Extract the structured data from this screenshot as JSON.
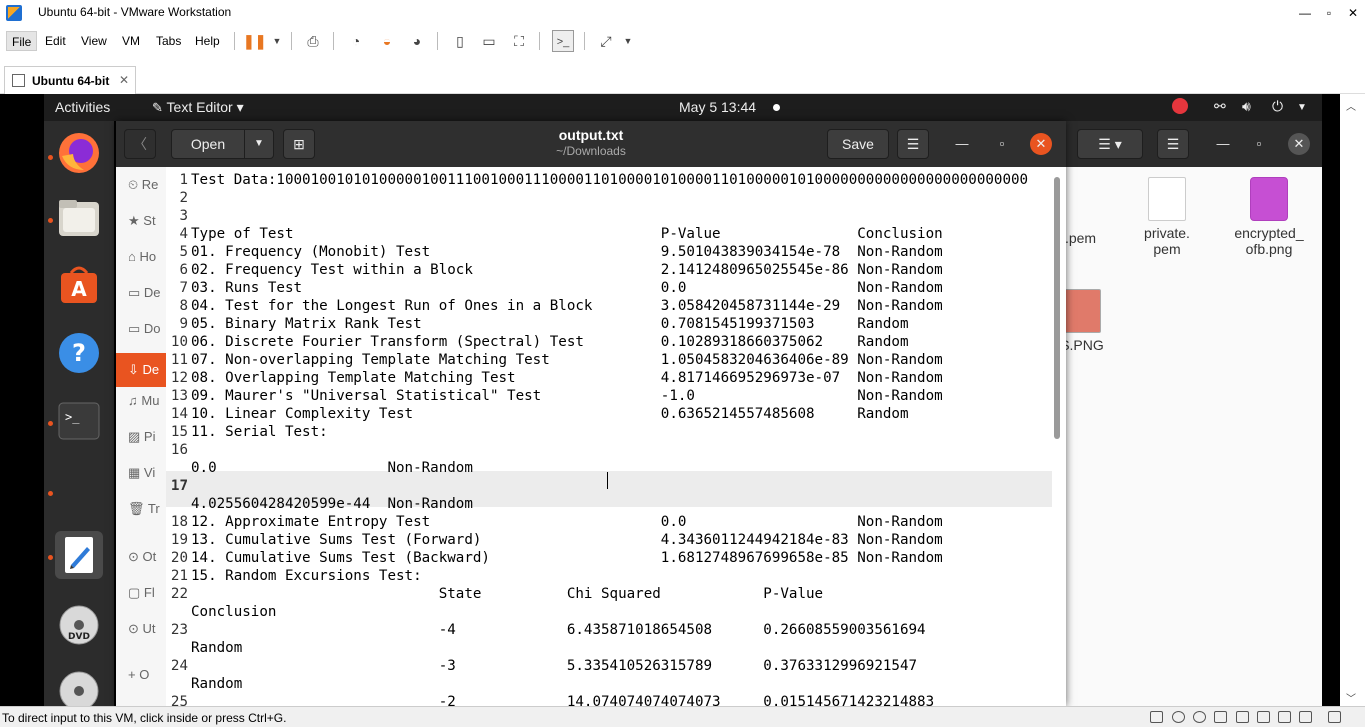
{
  "host": {
    "title": "Ubuntu 64-bit - VMware Workstation",
    "menu": [
      "File",
      "Edit",
      "View",
      "VM",
      "Tabs",
      "Help"
    ],
    "tab_label": "Ubuntu 64-bit",
    "status_text": "To direct input to this VM, click inside or press Ctrl+G."
  },
  "gnome": {
    "activities": "Activities",
    "app_menu": "Text Editor ▾",
    "clock": "May 5  13:44"
  },
  "gedit": {
    "open_label": "Open",
    "save_label": "Save",
    "title": "output.txt",
    "subtitle": "~/Downloads",
    "sidebar": [
      "Re",
      "St",
      "Ho",
      "De",
      "Do",
      "De",
      "Mu",
      "Pi",
      "Vi",
      "Tr",
      "Ot",
      "Fl",
      "Ut",
      "O"
    ]
  },
  "files": {
    "items": [
      {
        "name": "c.pem"
      },
      {
        "name": "private.\npem"
      },
      {
        "name": "encrypted_\nofb.png"
      },
      {
        "name": "S.PNG"
      }
    ]
  },
  "editor_lines": [
    {
      "n": "1",
      "t": "Test Data:1000100101010000010011100100011100001101000010100001101000001010000000000000000000000000"
    },
    {
      "n": "2",
      "t": ""
    },
    {
      "n": "3",
      "t": ""
    },
    {
      "n": "4",
      "t": "Type of Test                                           P-Value                Conclusion"
    },
    {
      "n": "5",
      "t": "01. Frequency (Monobit) Test                           9.501043839034154e-78  Non-Random"
    },
    {
      "n": "6",
      "t": "02. Frequency Test within a Block                      2.1412480965025545e-86 Non-Random"
    },
    {
      "n": "7",
      "t": "03. Runs Test                                          0.0                    Non-Random"
    },
    {
      "n": "8",
      "t": "04. Test for the Longest Run of Ones in a Block        3.058420458731144e-29  Non-Random"
    },
    {
      "n": "9",
      "t": "05. Binary Matrix Rank Test                            0.7081545199371503     Random"
    },
    {
      "n": "10",
      "t": "06. Discrete Fourier Transform (Spectral) Test         0.10289318660375062    Random"
    },
    {
      "n": "11",
      "t": "07. Non-overlapping Template Matching Test             1.0504583204636406e-89 Non-Random"
    },
    {
      "n": "12",
      "t": "08. Overlapping Template Matching Test                 4.817146695296973e-07  Non-Random"
    },
    {
      "n": "13",
      "t": "09. Maurer's \"Universal Statistical\" Test              -1.0                   Non-Random"
    },
    {
      "n": "14",
      "t": "10. Linear Complexity Test                             0.6365214557485608     Random"
    },
    {
      "n": "15",
      "t": "11. Serial Test:"
    },
    {
      "n": "16",
      "t": ""
    },
    {
      "n": "",
      "t": "0.0                    Non-Random"
    },
    {
      "n": "17",
      "t": ""
    },
    {
      "n": "",
      "t": "4.025560428420599e-44  Non-Random"
    },
    {
      "n": "18",
      "t": "12. Approximate Entropy Test                           0.0                    Non-Random"
    },
    {
      "n": "19",
      "t": "13. Cumulative Sums Test (Forward)                     4.3436011244942184e-83 Non-Random"
    },
    {
      "n": "20",
      "t": "14. Cumulative Sums Test (Backward)                    1.6812748967699658e-85 Non-Random"
    },
    {
      "n": "21",
      "t": "15. Random Excursions Test:"
    },
    {
      "n": "22",
      "t": "                             State          Chi Squared            P-Value"
    },
    {
      "n": "",
      "t": "Conclusion"
    },
    {
      "n": "23",
      "t": "                             -4             6.435871018654508      0.26608559003561694"
    },
    {
      "n": "",
      "t": "Random"
    },
    {
      "n": "24",
      "t": "                             -3             5.335410526315789      0.3763312996921547"
    },
    {
      "n": "",
      "t": "Random"
    },
    {
      "n": "25",
      "t": "                             -2             14.074074074074073     0.015145671423214883"
    }
  ]
}
